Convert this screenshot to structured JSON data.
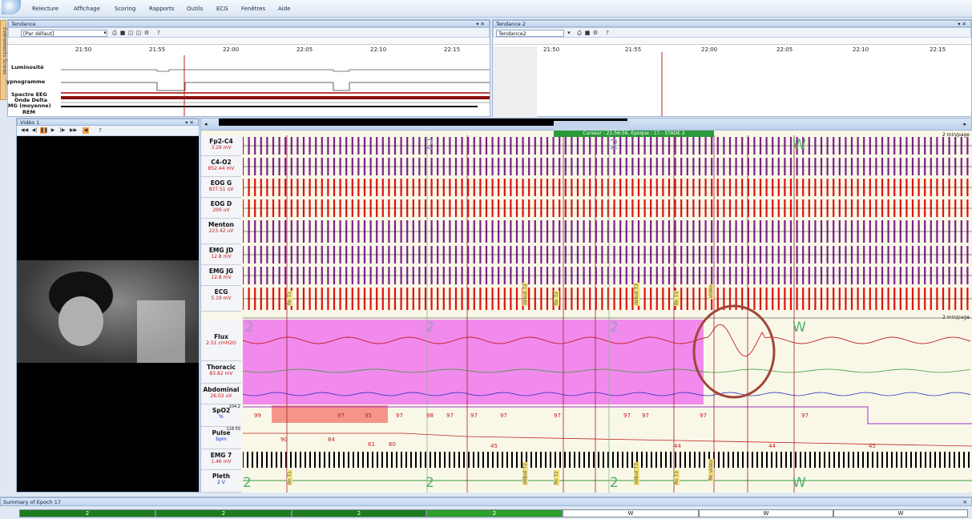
{
  "menu": [
    "Relecture",
    "Affichage",
    "Scoring",
    "Rapports",
    "Outils",
    "ECG",
    "Fenêtres",
    "Aide"
  ],
  "side_tab": "Evénements Scores",
  "trend1": {
    "title": "Tendance",
    "combo": "[Par défaut]",
    "times": [
      "21:50",
      "21:55",
      "22:00",
      "22:05",
      "22:10",
      "22:15"
    ],
    "rows": [
      "Luminosité",
      "ypnogramme",
      "Spectre EEG",
      "Onde Delta",
      "MG (moyenne)",
      "REM"
    ]
  },
  "trend2": {
    "title": "Tendance 2",
    "combo": "Tendance2",
    "times": [
      "21:50",
      "21:55",
      "22:00",
      "22:05",
      "22:10",
      "22:15"
    ]
  },
  "video": {
    "title": "Vidéo 1"
  },
  "cursor_label": "Curseur : 21:56:56, Époque : 17 - STADE 2",
  "page_rate": "2 min/page",
  "eeg_channels": [
    {
      "name": "Fp2-C4",
      "value": "3.29 mV"
    },
    {
      "name": "C4-O2",
      "value": "852.44 mV"
    },
    {
      "name": "EOG G",
      "value": "837.51 uV"
    },
    {
      "name": "EOG D",
      "value": "200 uV"
    },
    {
      "name": "Menton",
      "value": "223.42 uV"
    },
    {
      "name": "EMG JD",
      "value": "12.8 mV"
    },
    {
      "name": "EMG JG",
      "value": "12.8 mV"
    },
    {
      "name": "ECG",
      "value": "5.19 mV"
    }
  ],
  "resp_channels": [
    {
      "name": "Flux",
      "value": "2.51 cmH2O"
    },
    {
      "name": "Thoracic",
      "value": "83.82 mV"
    },
    {
      "name": "Abdominal",
      "value": "26.02 uV"
    },
    {
      "name": "SpO2",
      "value": "%",
      "scale": "104.2"
    },
    {
      "name": "Pulse",
      "value": "bpm",
      "scale": "118.55"
    },
    {
      "name": "EMG 7",
      "value": "1.46 mV"
    },
    {
      "name": "Pleth",
      "value": "2 V"
    }
  ],
  "spo2_values": [
    "99",
    "97",
    "95",
    "97",
    "98",
    "97",
    "97",
    "97",
    "97",
    "97",
    "97",
    "97",
    "97"
  ],
  "pulse_values": [
    "90",
    "84",
    "61",
    "60",
    "45",
    "44",
    "44",
    "45"
  ],
  "event_markers_top": [
    "fin T1",
    "début T2",
    "fin T2",
    "début T3",
    "fin T3",
    "vidéo"
  ],
  "event_markers_bottom": [
    "fin T1",
    "début T2",
    "fin T2",
    "début T3",
    "fin T3",
    "fin vidéo"
  ],
  "stages_top": [
    "2",
    "2",
    "W"
  ],
  "stages_bottom": [
    "2",
    "2",
    "2",
    "W"
  ],
  "summary": {
    "title": "Summary of Epoch 17",
    "epochs": [
      "2",
      "2",
      "2",
      "2",
      "W",
      "W",
      "W"
    ]
  },
  "colors": {
    "eeg": "#7b1f8f",
    "eog": "#e01010",
    "annotation": "#a24438",
    "highlight": "#ee66ee",
    "spo2_alert": "#f48a7e"
  }
}
